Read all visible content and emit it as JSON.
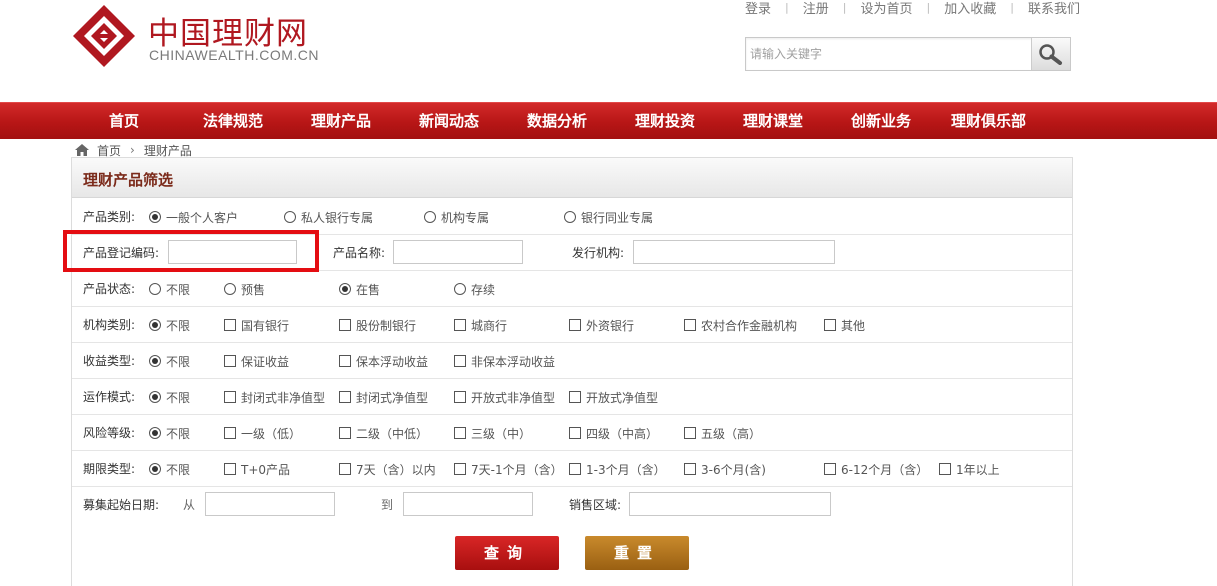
{
  "brand": {
    "name_cn": "中国理财网",
    "name_en": "CHINAWEALTH.COM.CN",
    "colors": {
      "primary": "#b01820",
      "nav": "#c11e1e",
      "highlight": "#e40d12",
      "reset_button": "#b37520"
    }
  },
  "top_links": [
    "登录",
    "注册",
    "设为首页",
    "加入收藏",
    "联系我们"
  ],
  "search": {
    "placeholder": "请输入关键字",
    "icon": "magnifier-icon"
  },
  "nav": [
    "首页",
    "法律规范",
    "理财产品",
    "新闻动态",
    "数据分析",
    "理财投资",
    "理财课堂",
    "创新业务",
    "理财俱乐部"
  ],
  "breadcrumb": {
    "home": "首页",
    "current": "理财产品"
  },
  "panel_title": "理财产品筛选",
  "filters": {
    "category": {
      "label": "产品类别:",
      "options": [
        "一般个人客户",
        "私人银行专属",
        "机构专属",
        "银行同业专属"
      ],
      "selected": 0
    },
    "reg_code": {
      "label": "产品登记编码:",
      "value": ""
    },
    "product_name": {
      "label": "产品名称:",
      "value": ""
    },
    "issuer": {
      "label": "发行机构:",
      "value": ""
    },
    "status": {
      "label": "产品状态:",
      "options": [
        "不限",
        "预售",
        "在售",
        "存续"
      ],
      "selected": 2
    },
    "institution": {
      "label": "机构类别:",
      "options": [
        "不限",
        "国有银行",
        "股份制银行",
        "城商行",
        "外资银行",
        "农村合作金融机构",
        "其他"
      ],
      "selected": 0
    },
    "yield_type": {
      "label": "收益类型:",
      "options": [
        "不限",
        "保证收益",
        "保本浮动收益",
        "非保本浮动收益"
      ],
      "selected": 0
    },
    "operation": {
      "label": "运作模式:",
      "options": [
        "不限",
        "封闭式非净值型",
        "封闭式净值型",
        "开放式非净值型",
        "开放式净值型"
      ],
      "selected": 0
    },
    "risk": {
      "label": "风险等级:",
      "options": [
        "不限",
        "一级（低）",
        "二级（中低）",
        "三级（中）",
        "四级（中高）",
        "五级（高）"
      ],
      "selected": 0
    },
    "term": {
      "label": "期限类型:",
      "options": [
        "不限",
        "T+0产品",
        "7天（含）以内",
        "7天-1个月（含）",
        "1-3个月（含）",
        "3-6个月(含)",
        "6-12个月（含）",
        "1年以上"
      ],
      "selected": 0
    },
    "raise_date": {
      "label": "募集起始日期:",
      "from": "从",
      "to": "到",
      "from_value": "",
      "to_value": ""
    },
    "region": {
      "label": "销售区域:",
      "value": ""
    }
  },
  "buttons": {
    "query": "查询",
    "reset": "重置"
  }
}
